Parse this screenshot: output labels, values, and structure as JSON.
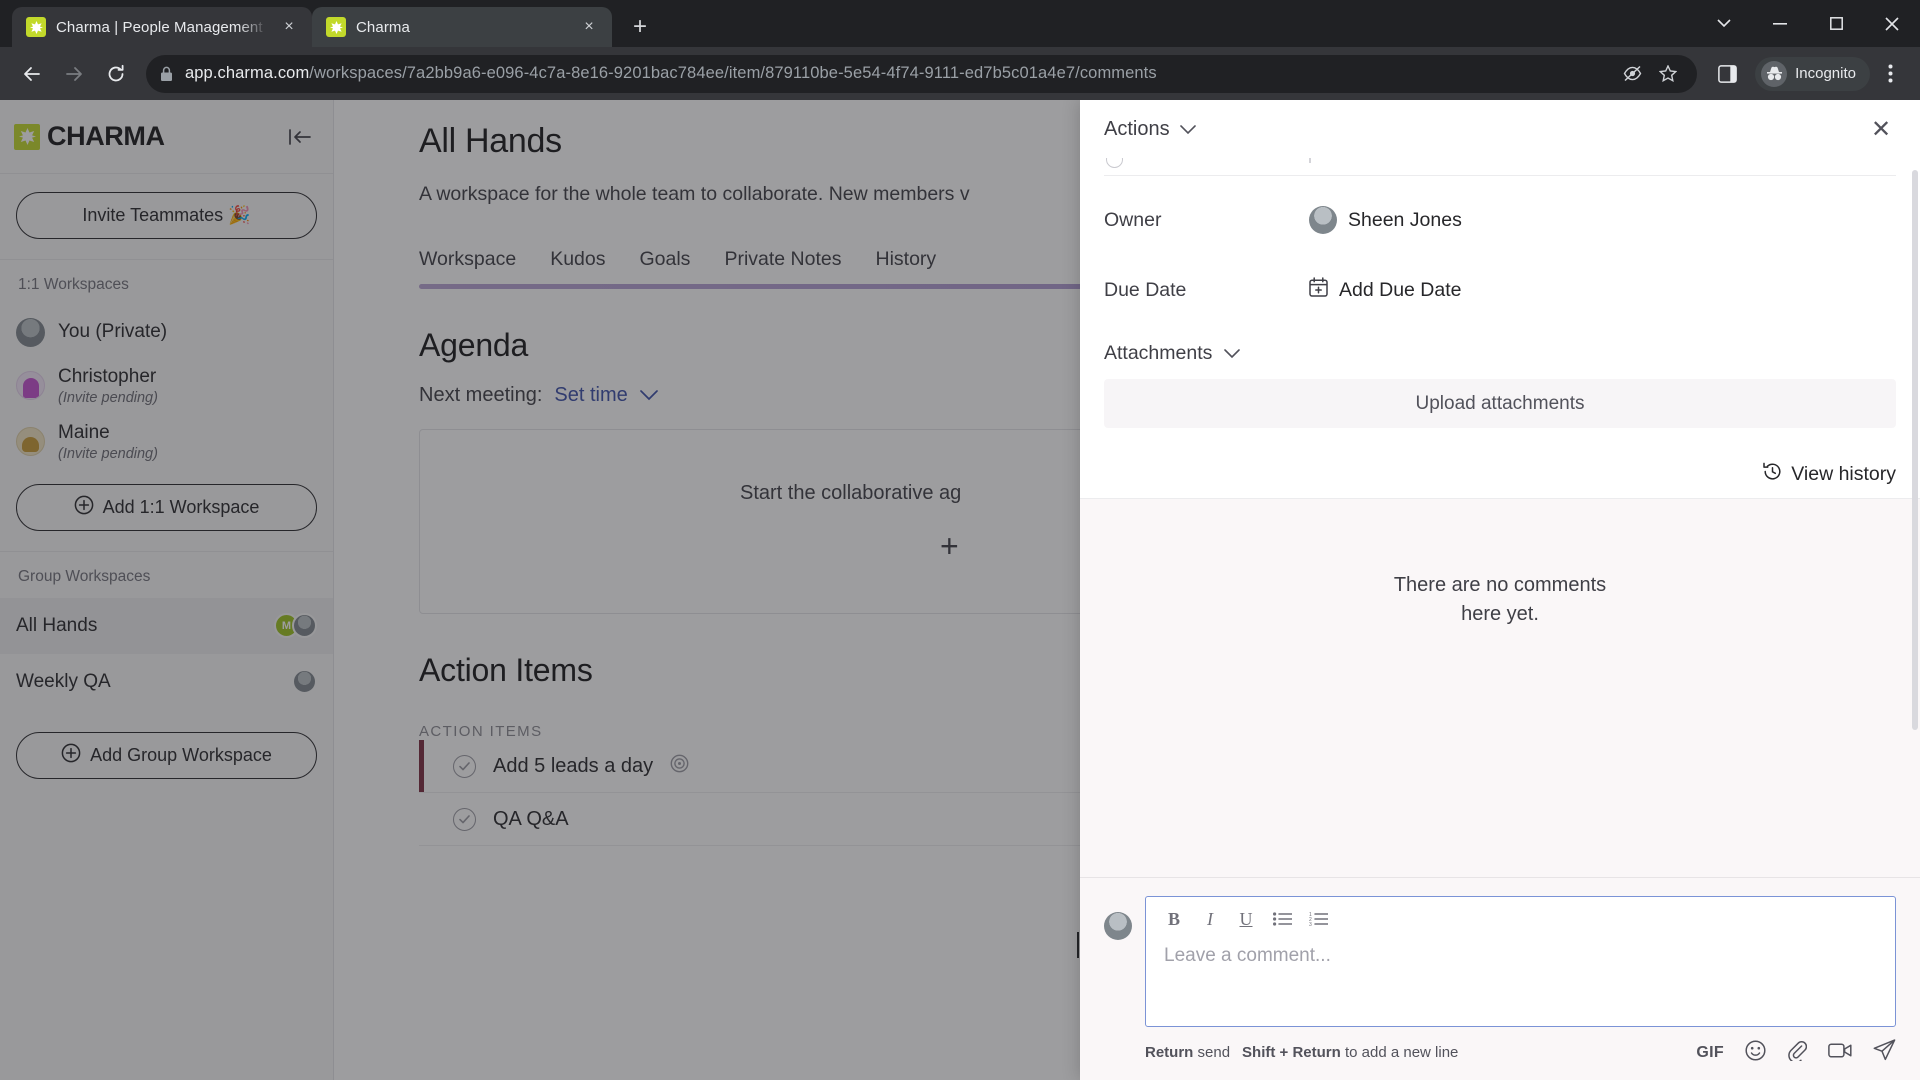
{
  "browser": {
    "tabs": [
      {
        "title": "Charma | People Management S",
        "favicon": "charma-favicon",
        "active": false
      },
      {
        "title": "Charma",
        "favicon": "charma-favicon",
        "active": true
      }
    ],
    "new_tab_label": "+",
    "close_label": "×",
    "url_host": "app.charma.com",
    "url_path": "/workspaces/7a2bb9a6-e096-4c7a-8e16-9201bac784ee/item/879110be-5e54-4f74-9111-ed7b5c01a4e7/comments",
    "profile_label": "Incognito",
    "window_controls": {
      "minimize": "—",
      "maximize": "☐",
      "close": "✕",
      "list_tabs": "⌄"
    }
  },
  "sidebar": {
    "brand": "CHARMA",
    "collapse_icon": "collapse-sidebar-icon",
    "invite_button": "Invite Teammates 🎉",
    "sections": [
      {
        "label": "1:1 Workspaces",
        "items": [
          {
            "name": "You (Private)",
            "sub": "",
            "avatar": "person"
          },
          {
            "name": "Christopher",
            "sub": "(Invite pending)",
            "avatar": "purple"
          },
          {
            "name": "Maine",
            "sub": "(Invite pending)",
            "avatar": "gold"
          }
        ],
        "add_button": "Add 1:1 Workspace"
      },
      {
        "label": "Group Workspaces",
        "items": [
          {
            "name": "All Hands",
            "active": true,
            "avatars": [
              "M",
              "person"
            ]
          },
          {
            "name": "Weekly QA",
            "active": false,
            "avatars": [
              "person"
            ]
          }
        ],
        "add_button": "Add Group Workspace"
      }
    ]
  },
  "main": {
    "title": "All Hands",
    "description": "A workspace for the whole team to collaborate. New members v",
    "tabs": [
      {
        "label": "Workspace"
      },
      {
        "label": "Kudos"
      },
      {
        "label": "Goals"
      },
      {
        "label": "Private Notes"
      },
      {
        "label": "History"
      }
    ],
    "agenda": {
      "heading": "Agenda",
      "next_meeting_label": "Next meeting:",
      "set_time_label": "Set time",
      "placeholder": "Start the collaborative ag",
      "add_icon": "+"
    },
    "action_items": {
      "heading": "Action Items",
      "list_label": "ACTION ITEMS",
      "items": [
        {
          "text": "Add 5 leads a day",
          "has_goal_icon": true,
          "selected": true
        },
        {
          "text": "QA Q&A",
          "has_goal_icon": false,
          "selected": false
        }
      ]
    }
  },
  "panel": {
    "actions_label": "Actions",
    "close_icon": "✕",
    "fields": [
      {
        "label": "Owner",
        "value": "Sheen Jones",
        "icon": "avatar"
      },
      {
        "label": "Due Date",
        "value": "Add Due Date",
        "icon": "calendar-plus-icon"
      }
    ],
    "attachments_label": "Attachments",
    "upload_label": "Upload attachments",
    "view_history_label": "View history",
    "empty_comments": {
      "line1": "There are no comments",
      "line2": "here yet."
    },
    "composer": {
      "placeholder": "Leave a comment...",
      "toolbar": [
        {
          "name": "bold",
          "glyph": "B"
        },
        {
          "name": "italic",
          "glyph": "I"
        },
        {
          "name": "underline",
          "glyph": "U"
        },
        {
          "name": "bulleted-list",
          "glyph": "☰"
        },
        {
          "name": "numbered-list",
          "glyph": "≣"
        }
      ],
      "hint_return": "Return",
      "hint_send": "send",
      "hint_shift_return": "Shift + Return",
      "hint_newline": "to add a new line",
      "gif_label": "GIF",
      "icons": [
        "gif-button",
        "emoji-icon",
        "attachment-icon",
        "video-icon",
        "send-icon"
      ]
    }
  },
  "colors": {
    "brand_green": "#c2d92b",
    "accent_purple": "#a58fd0",
    "selected_red": "#7a2b3f",
    "editor_focus": "#7b93d6"
  }
}
